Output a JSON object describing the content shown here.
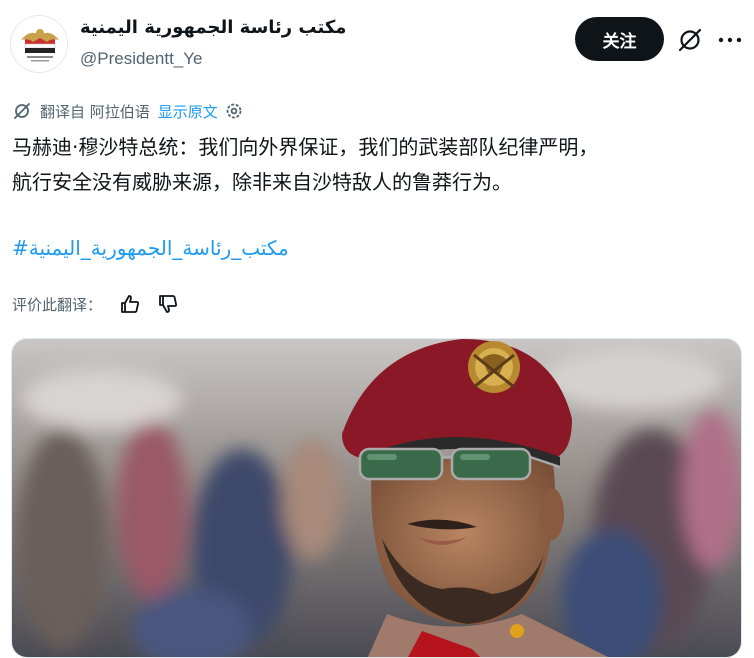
{
  "author": {
    "display_name": "مكتب رئاسة الجمهورية اليمنية",
    "handle": "@Presidentt_Ye",
    "avatar_icon": "yemen-eagle-emblem-icon"
  },
  "actions": {
    "follow_label": "关注",
    "grok_icon": "grok-icon",
    "more_icon": "more-dots-icon"
  },
  "translation": {
    "translated_from": "翻译自 阿拉伯语",
    "show_original": "显示原文",
    "settings_icon": "gear-icon"
  },
  "tweet": {
    "lines": [
      "马赫迪·穆沙特总统：我们向外界保证，我们的武装部队纪律严明，",
      "航行安全没有威胁来源，除非来自沙特敌人的鲁莽行为。"
    ],
    "hashtag": "#مكتب_رئاسة_الجمهورية_اليمنية"
  },
  "rating": {
    "label": "评价此翻译：",
    "like_icon": "thumbs-up-icon",
    "dislike_icon": "thumbs-down-icon"
  },
  "media": {
    "description_icon": "photo-man-in-red-beret"
  },
  "colors": {
    "text": "#0f1419",
    "secondary": "#536471",
    "link": "#1d9bf0",
    "follow_bg": "#0f1419"
  }
}
